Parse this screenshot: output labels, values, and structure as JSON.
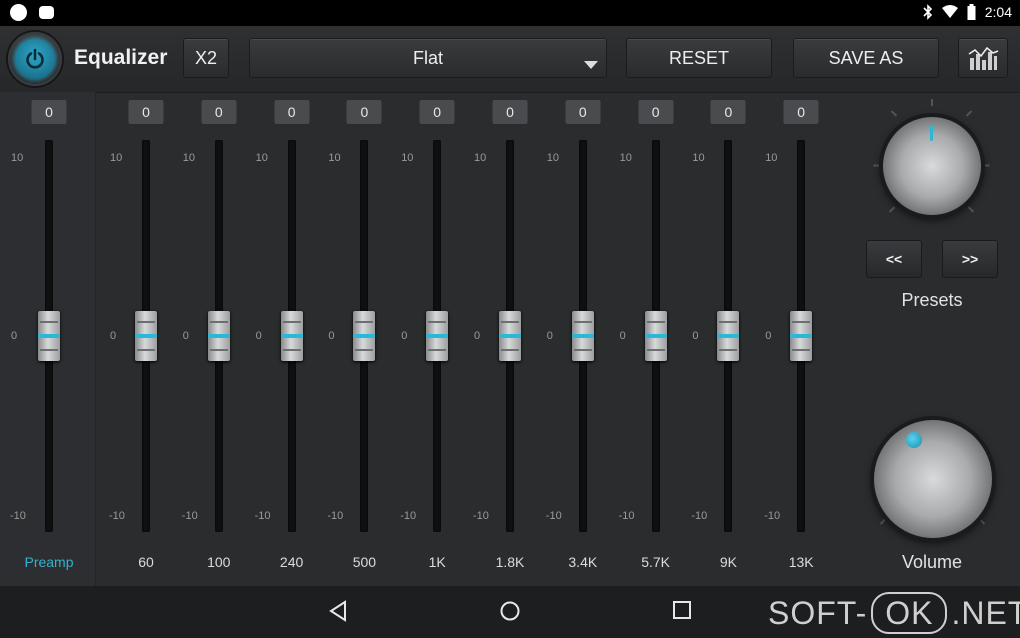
{
  "status_bar": {
    "time": "2:04",
    "icons": [
      "app-icon",
      "android-icon",
      "bluetooth-icon",
      "wifi-icon",
      "battery-icon"
    ]
  },
  "toolbar": {
    "title": "Equalizer",
    "x2_label": "X2",
    "preset_selected": "Flat",
    "reset_label": "RESET",
    "save_as_label": "SAVE AS",
    "power_on": true
  },
  "scale": {
    "max": "10",
    "mid": "0",
    "min": "-10"
  },
  "preamp": {
    "value": "0",
    "label": "Preamp",
    "level": 0
  },
  "bands": [
    {
      "freq": "60",
      "value": "0",
      "level": 0
    },
    {
      "freq": "100",
      "value": "0",
      "level": 0
    },
    {
      "freq": "240",
      "value": "0",
      "level": 0
    },
    {
      "freq": "500",
      "value": "0",
      "level": 0
    },
    {
      "freq": "1K",
      "value": "0",
      "level": 0
    },
    {
      "freq": "1.8K",
      "value": "0",
      "level": 0
    },
    {
      "freq": "3.4K",
      "value": "0",
      "level": 0
    },
    {
      "freq": "5.7K",
      "value": "0",
      "level": 0
    },
    {
      "freq": "9K",
      "value": "0",
      "level": 0
    },
    {
      "freq": "13K",
      "value": "0",
      "level": 0
    }
  ],
  "presets": {
    "prev_label": "<<",
    "next_label": ">>",
    "label": "Presets"
  },
  "volume": {
    "label": "Volume"
  },
  "watermark": {
    "part1": "SOFT-",
    "part2": "OK",
    "part3": ".NET"
  },
  "colors": {
    "accent": "#2bb7d6",
    "background": "#2b2c2e"
  }
}
